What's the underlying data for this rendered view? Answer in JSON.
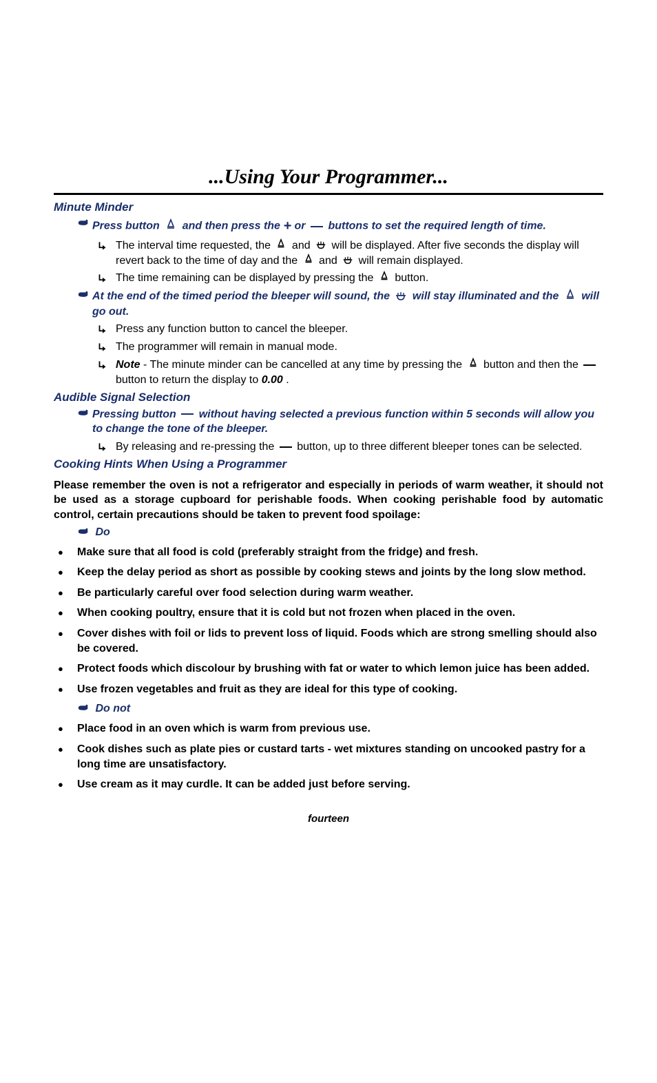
{
  "title": "...Using Your Programmer...",
  "section1": {
    "heading": "Minute Minder",
    "instr1_a": "Press button ",
    "instr1_b": " and then press the ",
    "instr1_c": " or ",
    "instr1_d": " buttons to set the required length of time.",
    "sub1_a": "The interval time requested, the",
    "sub1_b": " and ",
    "sub1_c": " will be displayed. After five seconds the display will revert back to the time of day and the ",
    "sub1_d": " and ",
    "sub1_e": " will remain displayed.",
    "sub2_a": "The time remaining can be displayed by pressing the ",
    "sub2_b": " button.",
    "instr2_a": "At the end of the timed period the bleeper will sound, the ",
    "instr2_b": " will stay illuminated and the ",
    "instr2_c": " will go out.",
    "sub3": "Press any function button to cancel the bleeper.",
    "sub4": "The programmer will remain in manual mode.",
    "sub5_label": "Note",
    "sub5_a": " - The minute minder can be cancelled at any time by pressing the ",
    "sub5_b": " button and then the ",
    "sub5_c": " button to return the display to ",
    "sub5_d": "0.00",
    "sub5_e": "."
  },
  "section2": {
    "heading": "Audible Signal Selection",
    "instr_a": "Pressing button ",
    "instr_b": " without having selected a previous function within 5 seconds will allow you to change the tone of the bleeper.",
    "sub_a": "By releasing and re-pressing the ",
    "sub_b": " button, up to three different bleeper tones can be selected."
  },
  "section3": {
    "heading": "Cooking Hints When Using a Programmer",
    "intro": "Please remember the oven is not a refrigerator and especially in periods of warm weather, it should not be used as a storage cupboard for perishable foods. When cooking perishable food by automatic control, certain precautions should be taken to prevent food spoilage:",
    "do_label": "Do",
    "do_items": [
      "Make sure that all food is cold (preferably straight from the fridge) and fresh.",
      "Keep the delay period as short as possible by cooking stews and joints by the long slow method.",
      "Be particularly careful over food selection during warm weather.",
      "When cooking poultry, ensure that it is cold but not frozen when placed in the oven.",
      "Cover dishes with foil or lids to prevent loss of liquid. Foods which are strong smelling should also be covered.",
      "Protect foods which discolour by brushing with fat or water to which lemon juice has been added.",
      "Use frozen vegetables and fruit as they are ideal for this type of cooking."
    ],
    "donot_label": "Do not",
    "donot_items": [
      "Place food in an oven which is warm from previous use.",
      "Cook dishes such as plate pies or custard tarts - wet mixtures standing on uncooked pastry for a long time are unsatisfactory.",
      "Use cream as it may curdle. It can be added just before serving."
    ]
  },
  "footer": "fourteen",
  "icons": {
    "bell": "bell-icon",
    "pot": "pot-icon",
    "hand": "hand-pointer-icon",
    "arrow": "arrow-sub-icon",
    "plus": "plus-icon",
    "minus": "minus-icon"
  }
}
